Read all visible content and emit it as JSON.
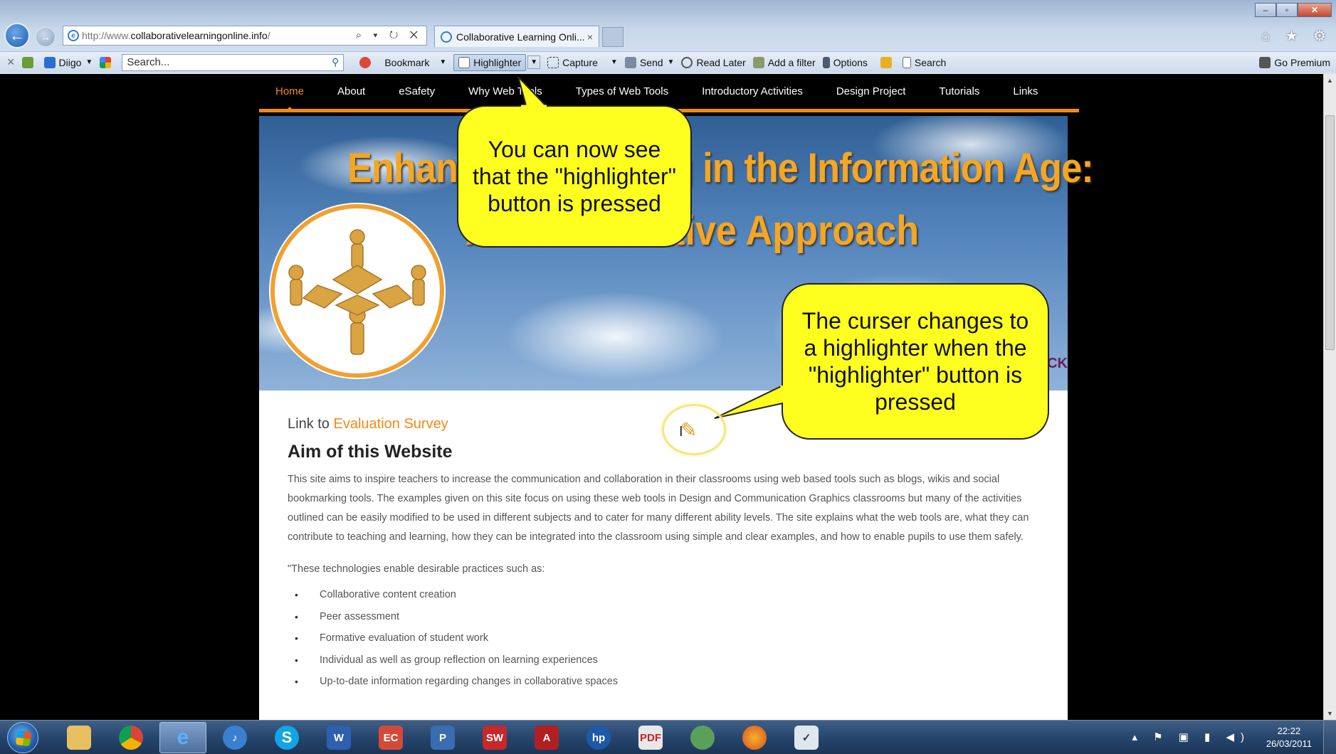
{
  "browser": {
    "address": {
      "prefix": "http://www.",
      "host": "collaborativelearningonline.info",
      "suffix": "/"
    },
    "address_icons": "⌕ ▾ ↻ ✕",
    "tab": {
      "title": "Collaborative Learning Onli...",
      "close": "×"
    },
    "window_buttons": {
      "minimize": "–",
      "restore": "▫",
      "close": "✕"
    },
    "right_icons": "⌂ ★ ⚙"
  },
  "toolbar": {
    "close": "×",
    "diigo": "Diigo",
    "search_placeholder": "Search...",
    "bookmark": "Bookmark",
    "highlighter": "Highlighter",
    "capture": "Capture",
    "send": "Send",
    "read_later": "Read Later",
    "add_filter": "Add a filter",
    "options": "Options",
    "search": "Search",
    "go_premium": "Go Premium"
  },
  "site": {
    "nav": [
      "Home",
      "About",
      "eSafety",
      "Why Web Tools",
      "Types of Web Tools",
      "Introductory Activities",
      "Design Project",
      "Tutorials",
      "Links"
    ],
    "banner": {
      "title_line1": "Enhancing Learning in the Information Age:",
      "title_line2": "A Collaborative Approach",
      "corner_text": "CK"
    },
    "survey_prefix": "Link to ",
    "survey_link": "Evaluation Survey",
    "aim_title": "Aim of this Website",
    "aim_text": "This site aims to inspire teachers to increase the communication and collaboration in their classrooms using web based tools such as blogs, wikis and social bookmarking tools. The examples given on this site focus on using these web tools in Design and Communication Graphics classrooms but many of the activities outlined can be easily modified to be used in different subjects and to cater for many different ability levels. The site explains what the web tools are, what they can contribute to teaching and learning, how they can be integrated into the classroom using simple and clear examples, and how to enable  pupils to use them safely.",
    "quote_intro": "\"These technologies enable desirable practices such as:",
    "bullets": [
      "Collaborative content creation",
      "Peer assessment",
      "Formative evaluation of student work",
      "Individual as well as group reflection on learning experiences",
      "Up-to-date information regarding changes in collaborative spaces"
    ]
  },
  "callouts": {
    "highlighter_pressed": "You can now see that the \"highlighter\" button is pressed",
    "cursor_changes": "The curser changes to a highlighter when the \"highlighter\" button is pressed"
  },
  "taskbar": {
    "apps": [
      "explorer",
      "chrome",
      "internet-explorer",
      "itunes",
      "skype",
      "word",
      "app-ec",
      "project",
      "solidworks",
      "autocad",
      "hp",
      "pdf-tool",
      "messenger",
      "firefox",
      "scheduler"
    ],
    "tray": "▴ ⚑ ▣ ▮ ◀)",
    "time": "22:22",
    "date": "26/03/2011"
  },
  "colors": {
    "accent": "#f28a16",
    "callout": "#ffff1f"
  }
}
